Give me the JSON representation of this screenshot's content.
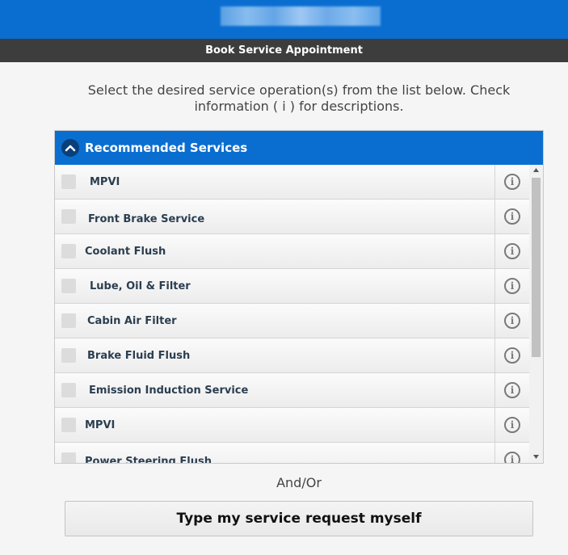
{
  "header": {
    "brand_blurred": true,
    "brand_color": "#0a6ed1"
  },
  "titlebar": {
    "title": "Book Service Appointment"
  },
  "instructions": {
    "line1": "Select the desired service operation(s) from the list below. Check",
    "line2": "information ( i ) for descriptions."
  },
  "panel": {
    "title": "Recommended Services",
    "collapse_icon": "chevron-up-icon",
    "info_icon_glyph": "i",
    "items": [
      {
        "label": "MPVI",
        "checked": false
      },
      {
        "label": "Front Brake Service",
        "checked": false
      },
      {
        "label": "Coolant Flush",
        "checked": false
      },
      {
        "label": "Lube, Oil & Filter",
        "checked": false
      },
      {
        "label": "Cabin Air Filter",
        "checked": false
      },
      {
        "label": "Brake Fluid Flush",
        "checked": false
      },
      {
        "label": "Emission Induction Service",
        "checked": false
      },
      {
        "label": "MPVI",
        "checked": false
      },
      {
        "label": "Power Steering Flush",
        "checked": false
      }
    ]
  },
  "andor": "And/Or",
  "type_request_button": "Type my service request myself"
}
